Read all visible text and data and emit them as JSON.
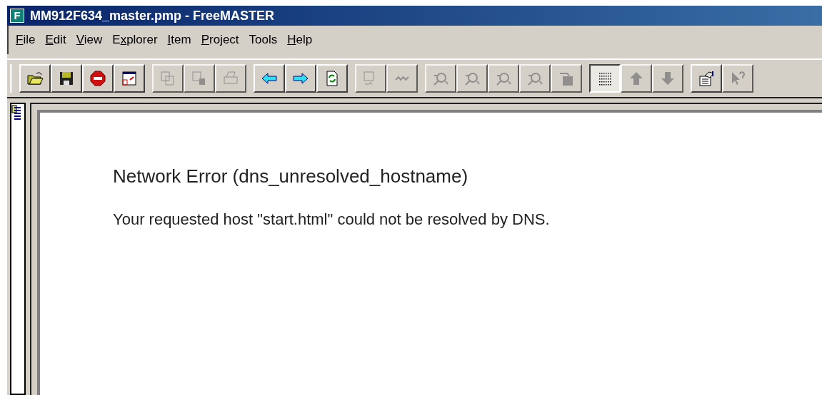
{
  "window": {
    "title": "MM912F634_master.pmp - FreeMASTER",
    "icon_letter": "F"
  },
  "menu": [
    {
      "key": "F",
      "post": "ile"
    },
    {
      "key": "E",
      "post": "dit"
    },
    {
      "key": "V",
      "post": "iew"
    },
    {
      "pre": "E",
      "key": "x",
      "post": "plorer"
    },
    {
      "key": "I",
      "post": "tem"
    },
    {
      "key": "P",
      "post": "roject"
    },
    {
      "pre": "Tools"
    },
    {
      "key": "H",
      "post": "elp"
    }
  ],
  "toolbar": [
    [
      {
        "kind": "open",
        "disabled": false,
        "pressed": false
      },
      {
        "kind": "save",
        "disabled": false,
        "pressed": false
      },
      {
        "kind": "stop",
        "disabled": false,
        "pressed": false
      },
      {
        "kind": "layout",
        "disabled": false,
        "pressed": false
      }
    ],
    [
      {
        "kind": "copy",
        "disabled": true,
        "pressed": false
      },
      {
        "kind": "paste",
        "disabled": true,
        "pressed": false
      },
      {
        "kind": "print",
        "disabled": true,
        "pressed": false
      }
    ],
    [
      {
        "kind": "back",
        "disabled": false,
        "pressed": false
      },
      {
        "kind": "forward",
        "disabled": false,
        "pressed": false
      },
      {
        "kind": "refresh",
        "disabled": false,
        "pressed": false
      }
    ],
    [
      {
        "kind": "watch",
        "disabled": true,
        "pressed": false
      },
      {
        "kind": "pipe",
        "disabled": true,
        "pressed": false
      }
    ],
    [
      {
        "kind": "probe",
        "disabled": true,
        "pressed": false
      },
      {
        "kind": "probe2",
        "disabled": true,
        "pressed": false
      },
      {
        "kind": "probe3",
        "disabled": true,
        "pressed": false
      },
      {
        "kind": "probe4",
        "disabled": true,
        "pressed": false
      },
      {
        "kind": "clip",
        "disabled": true,
        "pressed": false
      }
    ],
    [
      {
        "kind": "grid",
        "disabled": false,
        "pressed": true
      },
      {
        "kind": "up",
        "disabled": true,
        "pressed": false
      },
      {
        "kind": "down",
        "disabled": true,
        "pressed": false
      }
    ],
    [
      {
        "kind": "properties",
        "disabled": false,
        "pressed": false
      },
      {
        "kind": "help",
        "disabled": true,
        "pressed": false
      }
    ]
  ],
  "page": {
    "heading": "Network Error (dns_unresolved_hostname)",
    "message": "Your requested host \"start.html\" could not be resolved by DNS."
  }
}
